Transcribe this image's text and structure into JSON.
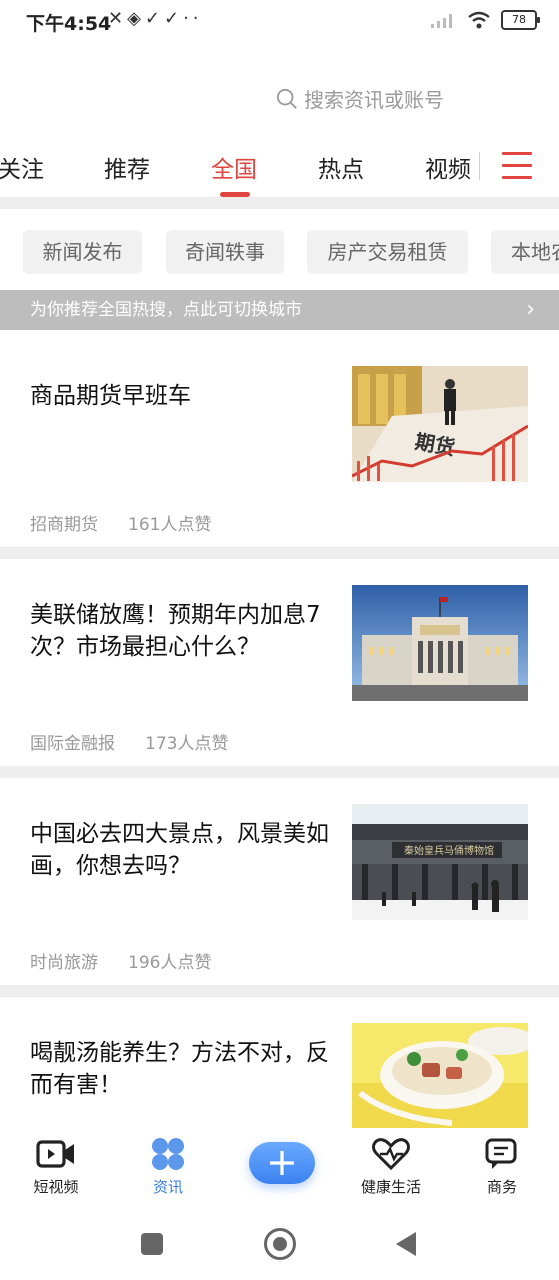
{
  "status": {
    "time": "下午4:54",
    "left_icons": "✕◈✓✓··",
    "battery": "78"
  },
  "search": {
    "placeholder": "搜索资讯或账号"
  },
  "tabs": [
    {
      "label": "关注"
    },
    {
      "label": "推荐"
    },
    {
      "label": "全国",
      "active": true
    },
    {
      "label": "热点"
    },
    {
      "label": "视频"
    }
  ],
  "chips": [
    {
      "label": "新闻发布"
    },
    {
      "label": "奇闻轶事"
    },
    {
      "label": "房产交易租赁"
    },
    {
      "label": "本地农"
    }
  ],
  "banner": {
    "text": "为你推荐全国热搜，点此可切换城市",
    "arrow": "›"
  },
  "articles": [
    {
      "title": "商品期货早班车",
      "source": "招商期货",
      "likes": "161人点赞",
      "image": "futures-image"
    },
    {
      "title": "美联储放鹰！预期年内加息7次？市场最担心什么？",
      "source": "国际金融报",
      "likes": "173人点赞",
      "image": "federal-reserve-image"
    },
    {
      "title": "中国必去四大景点，风景美如画，你想去吗？",
      "source": "时尚旅游",
      "likes": "196人点赞",
      "image": "scenic-building-image"
    },
    {
      "title": "喝靓汤能养生？方法不对，反而有害！",
      "image": "soup-image"
    }
  ],
  "bottom_nav": [
    {
      "label": "短视频",
      "icon": "video-icon"
    },
    {
      "label": "资讯",
      "icon": "news-grid-icon",
      "active": true
    },
    {
      "label": "",
      "icon": "plus-icon"
    },
    {
      "label": "健康生活",
      "icon": "heart-icon"
    },
    {
      "label": "商务",
      "icon": "chat-icon"
    }
  ],
  "colors": {
    "accent": "#e0453f",
    "nav_active": "#3a7fe0"
  }
}
